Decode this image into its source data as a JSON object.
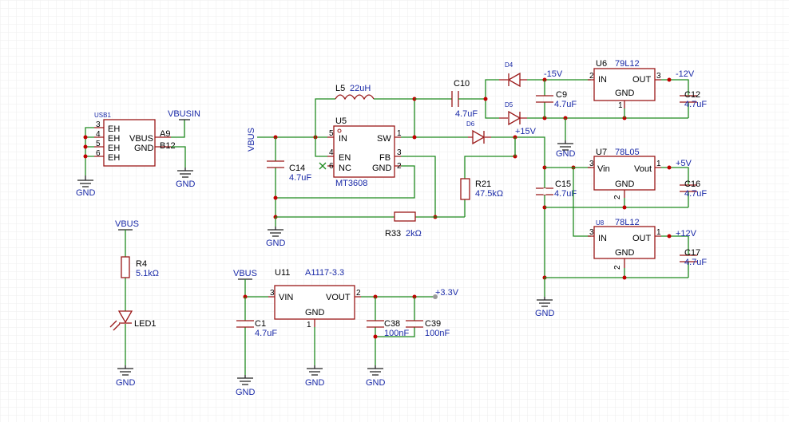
{
  "labels": {
    "usb1": "USB1",
    "vbusin": "VBUSIN",
    "gnd": "GND",
    "vbus": "VBUS",
    "vbus_vert": "VBUS",
    "eh": "EH",
    "vbus_pin": "VBUS",
    "gnd_pin": "GND",
    "a9": "A9",
    "b12": "B12",
    "n3": "3",
    "n4": "4",
    "n5": "5",
    "n6": "6",
    "l5": "L5",
    "l5_val": "22uH",
    "u5": "U5",
    "u5_val": "MT3608",
    "u5_in": "IN",
    "u5_sw": "SW",
    "u5_en": "EN",
    "u5_fb": "FB",
    "u5_nc": "NC",
    "u5_gnd": "GND",
    "u5_p1": "1",
    "u5_p2": "2",
    "u5_p3": "3",
    "u5_p4": "4",
    "u5_p5": "5",
    "u5_p6": "6",
    "c14": "C14",
    "c14_val": "4.7uF",
    "c10": "C10",
    "c10_val": "4.7uF",
    "d4": "D4",
    "d5": "D5",
    "d6": "D6",
    "minus15": "-15V",
    "plus15": "+15V",
    "c9": "C9",
    "c9_val": "4.7uF",
    "u6": "U6",
    "u6_val": "79L12",
    "u6_in": "IN",
    "u6_out": "OUT",
    "u6_gnd": "GND",
    "minus12": "-12V",
    "c12": "C12",
    "c12_val": "4.7uF",
    "u7": "U7",
    "u7_val": "78L05",
    "u7_vin": "Vin",
    "u7_vout": "Vout",
    "u7_gnd": "GND",
    "plus5": "+5V",
    "c16": "C16",
    "c16_val": "4.7uF",
    "c15": "C15",
    "c15_val": "4.7uF",
    "u8": "U8",
    "u8_val": "78L12",
    "u8_in": "IN",
    "u8_out": "OUT",
    "u8_gnd": "GND",
    "plus12": "+12V",
    "c17": "C17",
    "c17_val": "4.7uF",
    "r21": "R21",
    "r21_val": "47.5kΩ",
    "r33": "R33",
    "r33_val": "2kΩ",
    "r4": "R4",
    "r4_val": "5.1kΩ",
    "led1": "LED1",
    "u11": "U11",
    "u11_val": "A1117-3.3",
    "u11_vin": "VIN",
    "u11_vout": "VOUT",
    "u11_gnd": "GND",
    "c1": "C1",
    "c1_val": "4.7uF",
    "c38": "C38",
    "c38_val": "100nF",
    "c39": "C39",
    "c39_val": "100nF",
    "plus33": "+3.3V",
    "p1": "1",
    "p2": "2",
    "p3": "3"
  }
}
